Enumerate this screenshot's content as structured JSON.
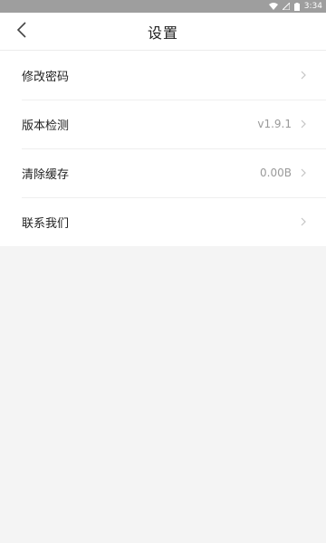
{
  "status_bar": {
    "time": "3:34",
    "icons": [
      "wifi-icon",
      "signal-icon",
      "battery-icon"
    ]
  },
  "header": {
    "title": "设置",
    "back_icon": "chevron-left-icon"
  },
  "settings": [
    {
      "label": "修改密码",
      "value": ""
    },
    {
      "label": "版本检测",
      "value": "v1.9.1"
    },
    {
      "label": "清除缓存",
      "value": "0.00B"
    },
    {
      "label": "联系我们",
      "value": ""
    }
  ],
  "colors": {
    "status_bar": "#9e9e9e",
    "background": "#f4f4f4",
    "surface": "#ffffff",
    "text": "#222222",
    "secondary_text": "#9a9a9a"
  }
}
